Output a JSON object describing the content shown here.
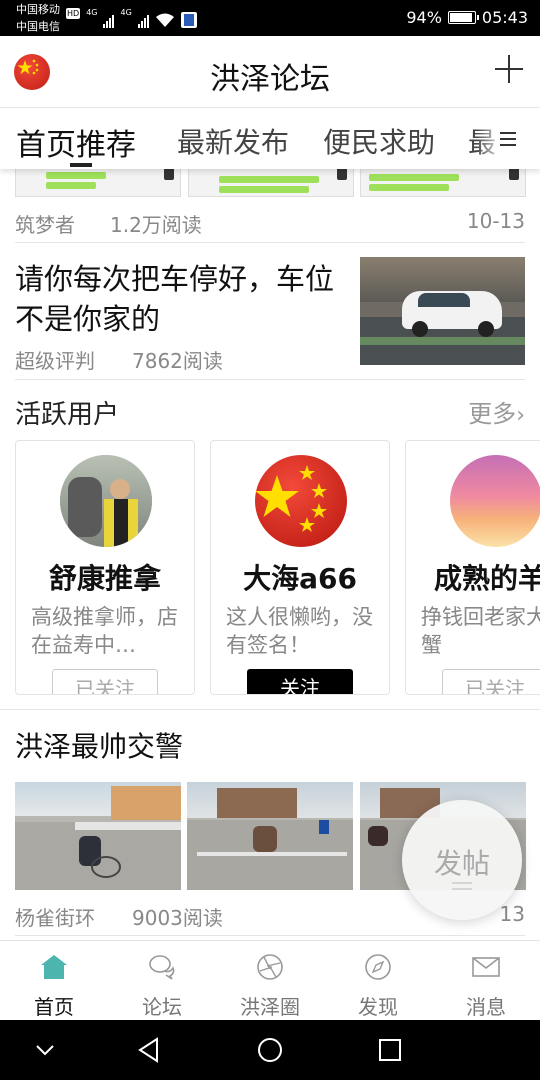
{
  "status_bar": {
    "carrier_1": "中国移动",
    "carrier_2": "中国电信",
    "network_1": "4G",
    "network_2": "4G",
    "hd_badge": "HD",
    "battery": "94%",
    "time": "05:43"
  },
  "header": {
    "title": "洪泽论坛",
    "avatar_icon": "china-flag-icon",
    "add_icon": "plus-icon"
  },
  "tabs": [
    {
      "label": "首页推荐"
    },
    {
      "label": "最新发布"
    },
    {
      "label": "便民求助"
    },
    {
      "label": "最"
    }
  ],
  "feed": {
    "top_post": {
      "author": "筑梦者",
      "reads": "1.2万阅读",
      "date": "10-13"
    },
    "post_2": {
      "title": "请你每次把车停好，车位不是你家的",
      "author": "超级评判",
      "reads": "7862阅读"
    },
    "active_users": {
      "section_title": "活跃用户",
      "more": "更多",
      "users": [
        {
          "name": "舒康推拿",
          "desc": "高级推拿师，店在益寿中…",
          "button": "已关注"
        },
        {
          "name": "大海a66",
          "desc": "这人很懒哟，没有签名！",
          "button": "关注"
        },
        {
          "name": "成熟的羊",
          "desc": "挣钱回老家大闸蟹",
          "button": "已关注"
        }
      ]
    },
    "post_3": {
      "title": "洪泽最帅交警",
      "author": "杨雀街环",
      "reads": "9003阅读",
      "date": "13"
    }
  },
  "fab": {
    "label": "发帖"
  },
  "bottom_nav": [
    {
      "label": "首页",
      "icon": "home-icon"
    },
    {
      "label": "论坛",
      "icon": "chat-bubbles-icon"
    },
    {
      "label": "洪泽圈",
      "icon": "aperture-icon"
    },
    {
      "label": "发现",
      "icon": "compass-icon"
    },
    {
      "label": "消息",
      "icon": "mail-icon"
    }
  ],
  "colors": {
    "accent": "#4cb5ad",
    "follow_button": "#000000"
  }
}
